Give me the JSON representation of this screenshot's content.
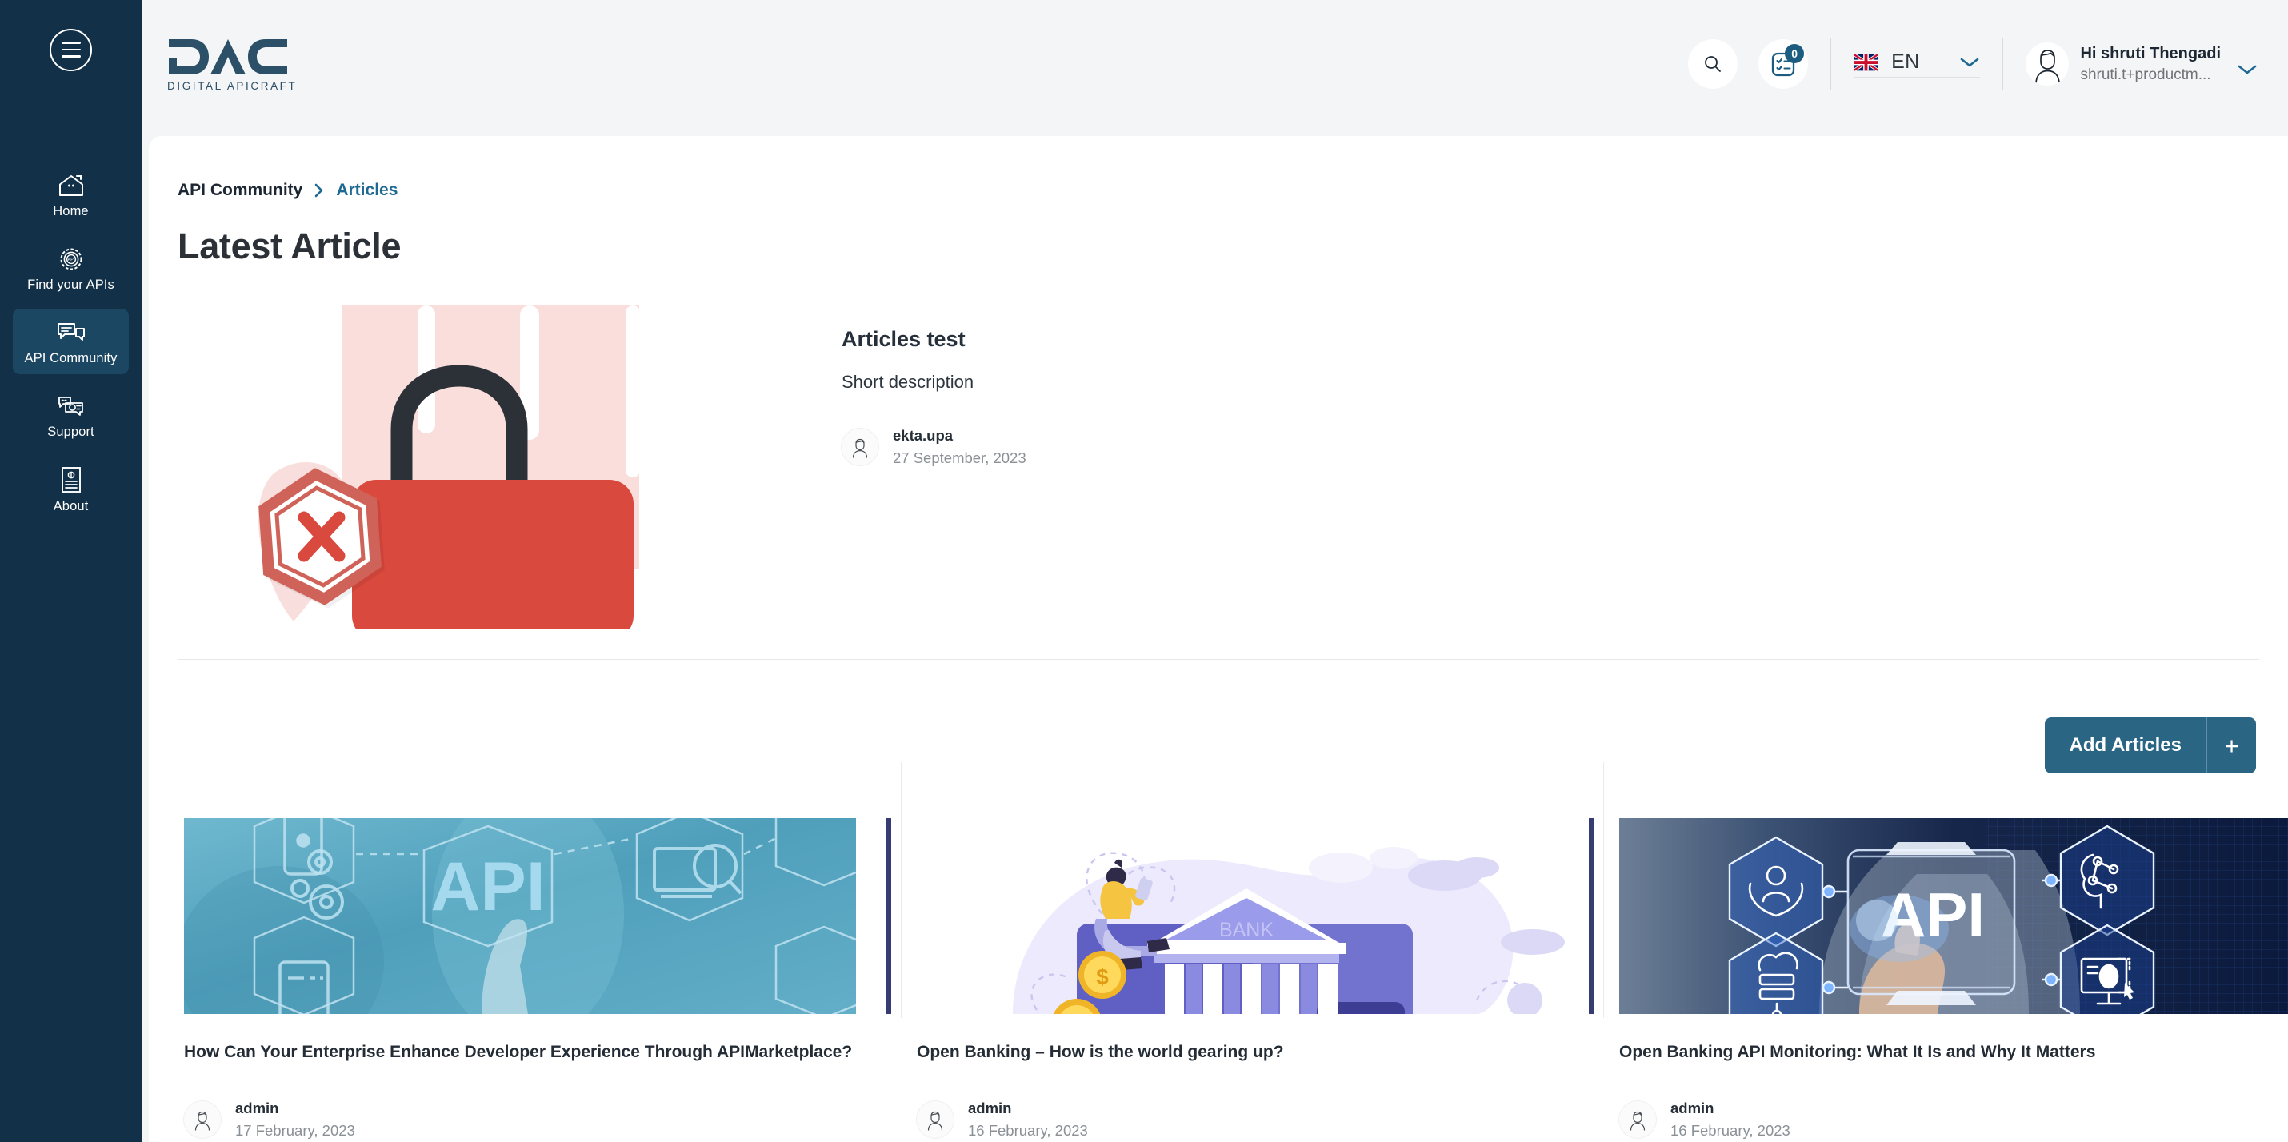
{
  "sidebar": {
    "menu_icon": "hamburger-icon",
    "items": [
      {
        "label": "Home",
        "icon": "home-icon",
        "active": false
      },
      {
        "label": "Find your APIs",
        "icon": "api-gear-icon",
        "active": false
      },
      {
        "label": "API Community",
        "icon": "chat-bubbles-icon",
        "active": true
      },
      {
        "label": "Support",
        "icon": "support-chat-icon",
        "active": false
      },
      {
        "label": "About",
        "icon": "document-info-icon",
        "active": false
      }
    ]
  },
  "topbar": {
    "logo_text": "DAC",
    "logo_subtitle": "DIGITAL APICRAFT",
    "search_icon": "search-icon",
    "notifications_icon": "tasklist-icon",
    "notifications_count": "0",
    "language": {
      "code": "EN",
      "flag": "uk-flag-icon",
      "chevron": "chevron-down-icon"
    },
    "user": {
      "greeting": "Hi shruti Thengadi",
      "email": "shruti.t+productm...",
      "avatar": "user-avatar-icon",
      "chevron": "chevron-down-icon"
    }
  },
  "breadcrumb": {
    "root": "API Community",
    "separator": "›",
    "current": "Articles"
  },
  "page": {
    "title": "Latest Article"
  },
  "featured": {
    "image_alt": "red-padlock-illustration",
    "title": "Articles test",
    "description": "Short description",
    "author": "ekta.upa",
    "date": "27 September, 2023"
  },
  "actions": {
    "add_articles_label": "Add Articles",
    "add_articles_plus": "+"
  },
  "articles": [
    {
      "title": "How Can Your Enterprise Enhance Developer Experience Through APIMarketplace?",
      "author": "admin",
      "date": "17 February, 2023",
      "thumb": "api-touchscreen-teal-image",
      "accent": false
    },
    {
      "title": "Open Banking – How is the world gearing up?",
      "author": "admin",
      "date": "16 February, 2023",
      "thumb": "open-banking-illustration-image",
      "accent": true
    },
    {
      "title": "Open Banking API Monitoring: What It Is and Why It Matters",
      "author": "admin",
      "date": "16 February, 2023",
      "thumb": "api-touchscreen-dark-blue-image",
      "accent": true
    }
  ],
  "colors": {
    "sidebar_bg": "#123047",
    "sidebar_active": "#1c4763",
    "accent_blue": "#1e6991",
    "button_blue": "#2b6584",
    "card_accent": "#373b73",
    "page_bg": "#f4f5f6",
    "panel_bg": "#ffffff"
  }
}
